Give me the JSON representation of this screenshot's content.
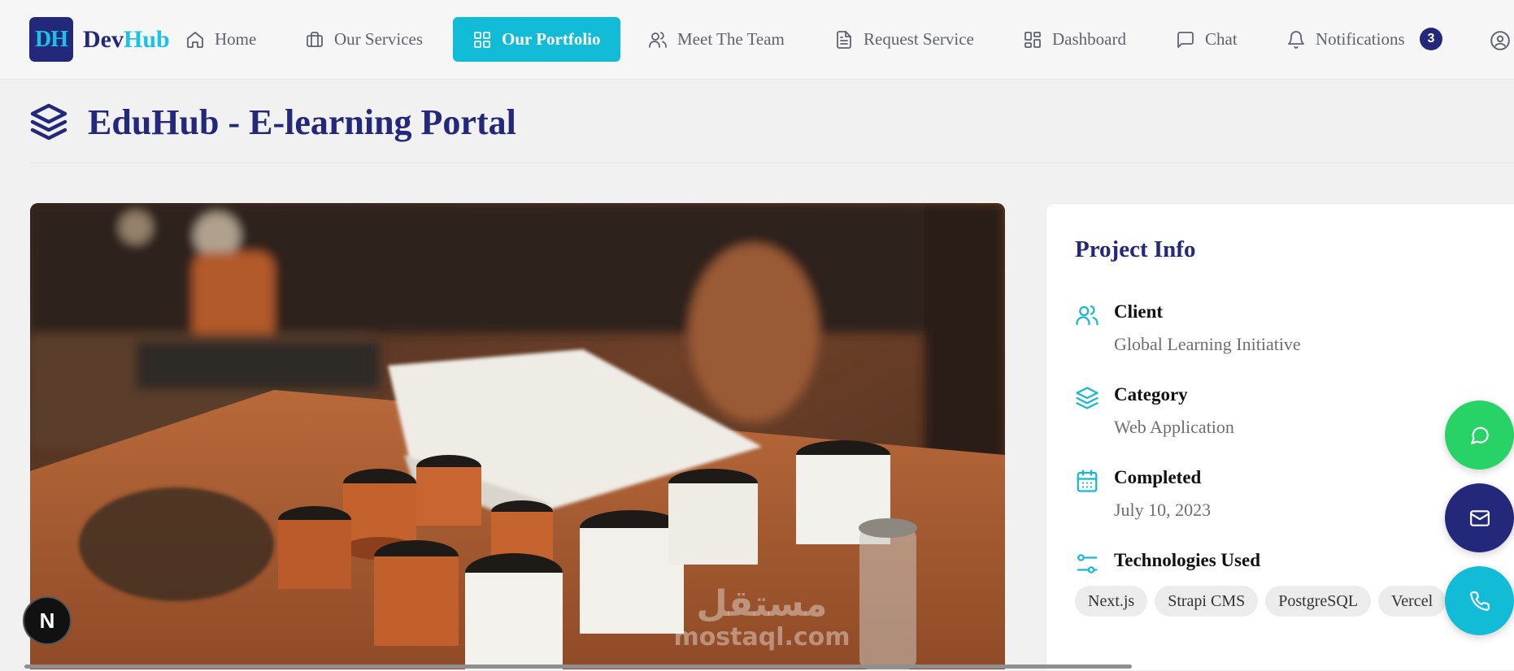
{
  "brand": {
    "mark": "DH",
    "name_part1": "Dev",
    "name_part2": "Hub"
  },
  "nav": {
    "home": "Home",
    "services": "Our Services",
    "portfolio": "Our Portfolio",
    "team": "Meet The Team",
    "request": "Request Service",
    "dashboard": "Dashboard",
    "chat": "Chat",
    "notifications": "Notifications",
    "notification_count": "3",
    "active_item": "Our Portfolio"
  },
  "page": {
    "title": "EduHub - E-learning Portal"
  },
  "hero_image": {
    "description_icon": "photo"
  },
  "project_info": {
    "title": "Project Info",
    "client_label": "Client",
    "client_value": "Global Learning Initiative",
    "category_label": "Category",
    "category_value": "Web Application",
    "completed_label": "Completed",
    "completed_value": "July 10, 2023",
    "tech_label": "Technologies Used",
    "technologies": [
      "Next.js",
      "Strapi CMS",
      "PostgreSQL",
      "Vercel"
    ]
  },
  "fabs": [
    "chat-icon",
    "mail-icon",
    "phone-icon"
  ],
  "next_badge": "N",
  "watermark": {
    "arabic": "مستقل",
    "latin": "mostaql.com"
  },
  "colors": {
    "primary": "#24287a",
    "accent": "#12bcd6",
    "whatsapp": "#27d366"
  }
}
